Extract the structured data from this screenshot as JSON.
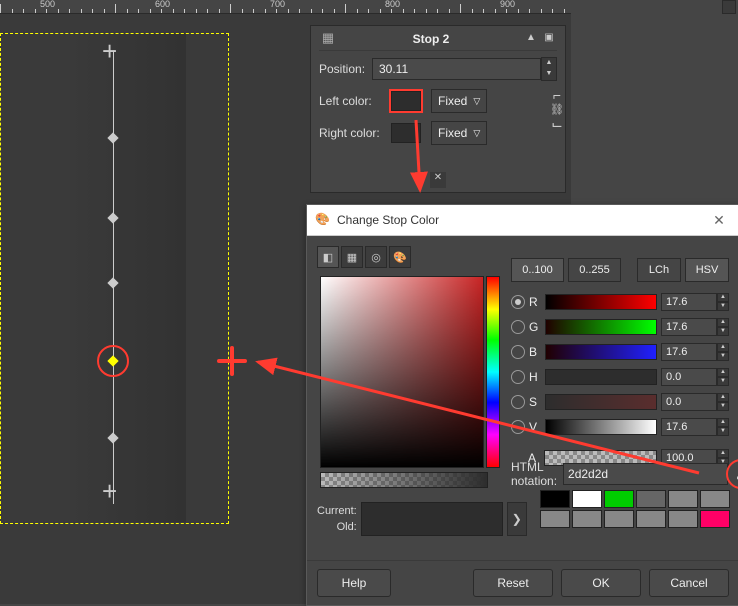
{
  "ruler": {
    "ticks": [
      500,
      600,
      700,
      800,
      900
    ]
  },
  "panel": {
    "title": "Stop 2",
    "position_label": "Position:",
    "position_value": "30.11",
    "left_label": "Left color:",
    "right_label": "Right color:",
    "fixed_label": "Fixed"
  },
  "dialog": {
    "title": "Change Stop Color",
    "range0": "0..100",
    "range1": "0..255",
    "model0": "LCh",
    "model1": "HSV",
    "channels": [
      {
        "l": "R",
        "v": "17.6",
        "rad": true,
        "grad": "linear-gradient(to right,#000,#f00)"
      },
      {
        "l": "G",
        "v": "17.6",
        "rad": false,
        "grad": "linear-gradient(to right,#200000,#0f0)"
      },
      {
        "l": "B",
        "v": "17.6",
        "rad": false,
        "grad": "linear-gradient(to right,#200000,#2020ff)"
      },
      {
        "l": "H",
        "v": "0.0",
        "rad": false,
        "grad": "linear-gradient(to right,#2d2d2d,#2d2d2d)"
      },
      {
        "l": "S",
        "v": "0.0",
        "rad": false,
        "grad": "linear-gradient(to right,#2d2d2d,#5a2d2d)"
      },
      {
        "l": "V",
        "v": "17.6",
        "rad": false,
        "grad": "linear-gradient(to right,#000,#fff)"
      },
      {
        "l": "A",
        "v": "100.0",
        "rad": null,
        "grad": "checker"
      }
    ],
    "html_label": "HTML notation:",
    "html_value": "2d2d2d",
    "current_label": "Current:",
    "old_label": "Old:",
    "palette": [
      "#000",
      "#fff",
      "#0c0",
      "#666",
      "#888",
      "#888",
      "#888",
      "#888",
      "#888",
      "#888",
      "#888",
      "#f06"
    ],
    "buttons": {
      "help": "Help",
      "reset": "Reset",
      "ok": "OK",
      "cancel": "Cancel"
    }
  }
}
